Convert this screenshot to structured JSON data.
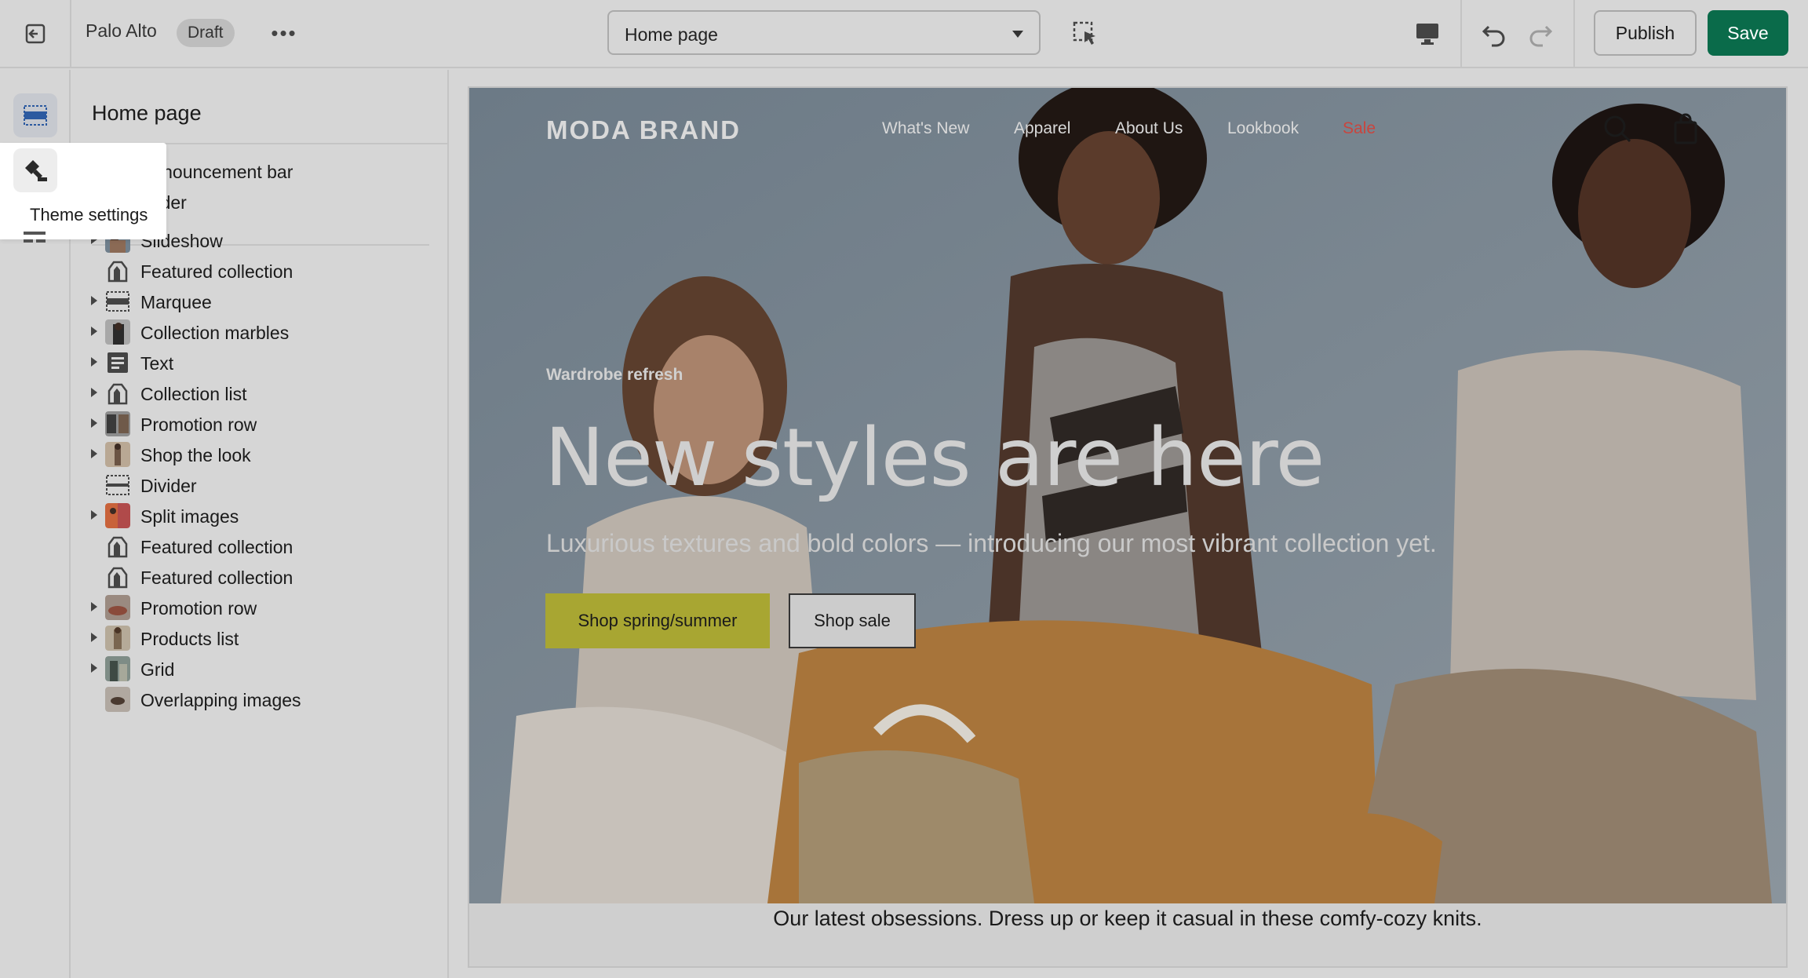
{
  "topbar": {
    "store_name": "Palo Alto",
    "status_badge": "Draft",
    "more_label": "•••",
    "page_selector_value": "Home page",
    "publish_label": "Publish",
    "save_label": "Save"
  },
  "rail": {
    "tooltip": "Theme settings"
  },
  "panel": {
    "title": "Home page",
    "sections": [
      {
        "label": "Announcement bar",
        "expandable": true,
        "icon": "announcement-bar-icon"
      },
      {
        "label": "eader",
        "expandable": false,
        "icon": "header-icon"
      },
      {
        "label": "Slideshow",
        "expandable": true,
        "icon": "slideshow-thumbnail"
      },
      {
        "label": "Featured collection",
        "expandable": false,
        "icon": "tag-icon"
      },
      {
        "label": "Marquee",
        "expandable": true,
        "icon": "marquee-icon"
      },
      {
        "label": "Collection marbles",
        "expandable": true,
        "icon": "collection-marbles-thumbnail"
      },
      {
        "label": "Text",
        "expandable": true,
        "icon": "text-icon"
      },
      {
        "label": "Collection list",
        "expandable": true,
        "icon": "tag-icon"
      },
      {
        "label": "Promotion row",
        "expandable": true,
        "icon": "promotion-row-thumbnail"
      },
      {
        "label": "Shop the look",
        "expandable": true,
        "icon": "shop-the-look-thumbnail"
      },
      {
        "label": "Divider",
        "expandable": false,
        "icon": "divider-icon"
      },
      {
        "label": "Split images",
        "expandable": true,
        "icon": "split-images-thumbnail"
      },
      {
        "label": "Featured collection",
        "expandable": false,
        "icon": "tag-icon"
      },
      {
        "label": "Featured collection",
        "expandable": false,
        "icon": "tag-icon"
      },
      {
        "label": "Promotion row",
        "expandable": true,
        "icon": "promotion-row-thumbnail"
      },
      {
        "label": "Products list",
        "expandable": true,
        "icon": "products-list-thumbnail"
      },
      {
        "label": "Grid",
        "expandable": true,
        "icon": "grid-thumbnail"
      },
      {
        "label": "Overlapping images",
        "expandable": false,
        "icon": "overlapping-images-thumbnail"
      }
    ]
  },
  "preview": {
    "brand": "MODA BRAND",
    "nav": [
      "What's New",
      "Apparel",
      "About Us",
      "Lookbook",
      "Sale"
    ],
    "kicker": "Wardrobe refresh",
    "headline": "New styles are here",
    "subhead": "Luxurious textures and bold colors — introducing our most vibrant collection yet.",
    "cta_primary": "Shop spring/summer",
    "cta_secondary": "Shop sale",
    "caption": "Our latest obsessions. Dress up or keep it casual in these comfy-cozy knits."
  },
  "colors": {
    "save_button": "#0a6b4a",
    "primary_cta": "#a8a632",
    "sale_link": "#c9453e"
  }
}
